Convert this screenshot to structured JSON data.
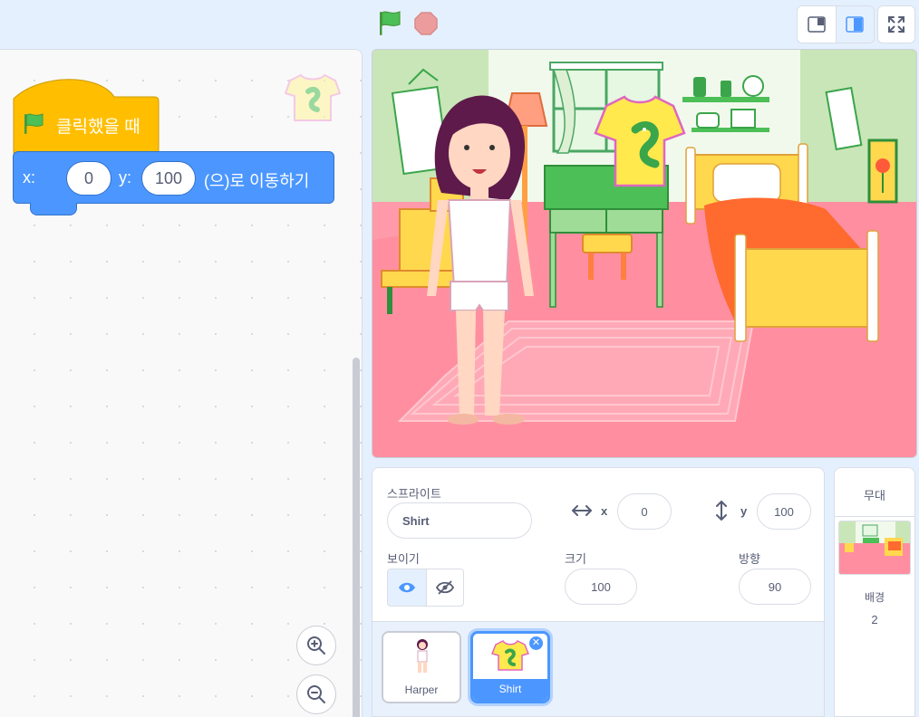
{
  "toolbar": {
    "green_flag": "green-flag-icon",
    "stop": "stop-icon",
    "colors": {
      "flag": "#4cbf56",
      "stop": "#ec9c9c"
    }
  },
  "workspace": {
    "hat_block": {
      "text": "클릭했을 때",
      "color": "#ffbf00"
    },
    "motion_block": {
      "x_label": "x:",
      "x_value": "0",
      "y_label": "y:",
      "y_value": "100",
      "suffix": "(으)로 이동하기",
      "color": "#4c97ff"
    }
  },
  "sprite_info": {
    "sprite_label": "스프라이트",
    "sprite_name": "Shirt",
    "x_label": "x",
    "x_value": "0",
    "y_label": "y",
    "y_value": "100",
    "show_label": "보이기",
    "size_label": "크기",
    "size_value": "100",
    "direction_label": "방향",
    "direction_value": "90"
  },
  "sprites": [
    {
      "name": "Harper",
      "selected": false
    },
    {
      "name": "Shirt",
      "selected": true
    }
  ],
  "stage_pane": {
    "title": "무대",
    "backdrops_label": "배경",
    "backdrops_count": "2"
  }
}
